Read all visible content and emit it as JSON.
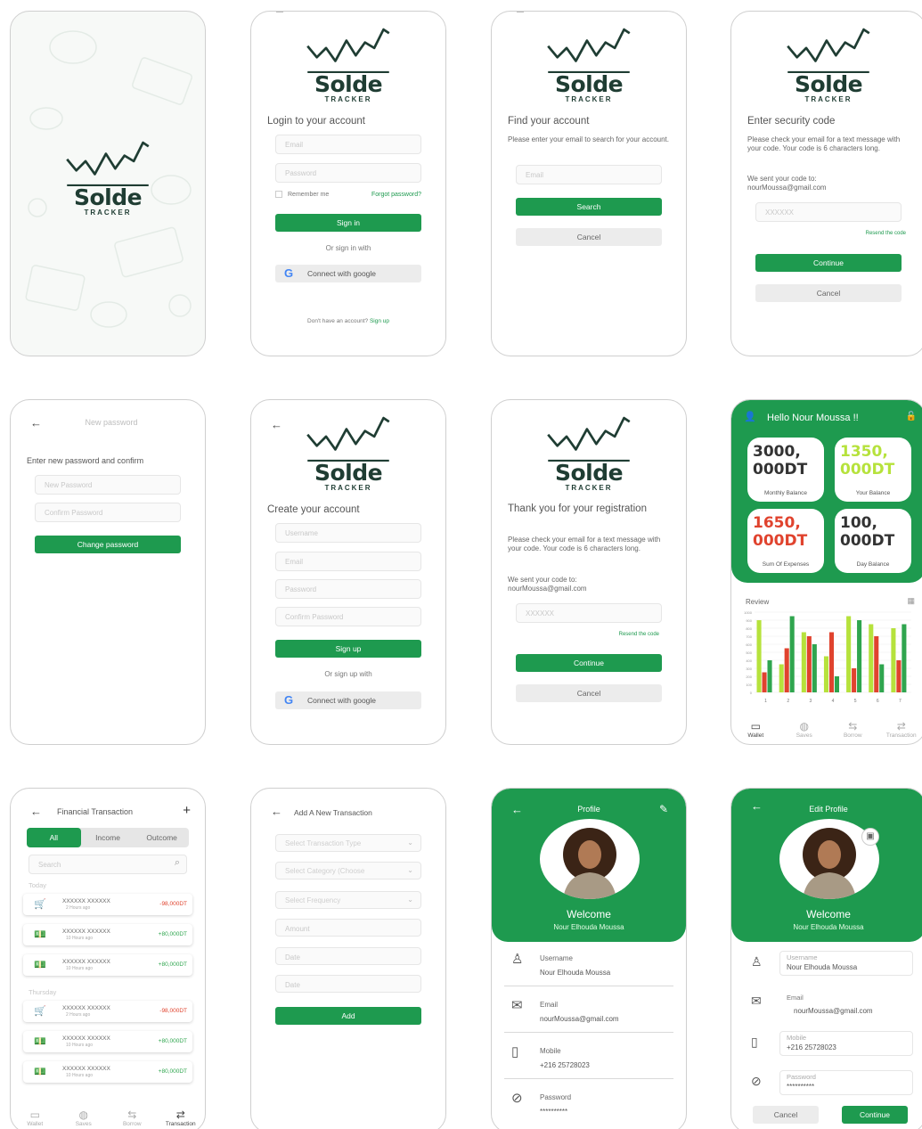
{
  "brand": {
    "name": "Solde",
    "sub": "TRACKER"
  },
  "login": {
    "heading": "Login to your account",
    "email_ph": "Email",
    "password_ph": "Password",
    "remember": "Remember me",
    "forgot": "Forgot password?",
    "signin": "Sign in",
    "or": "Or sign in with",
    "google": "Connect with google",
    "no_account": "Don't have an account?",
    "signup_link": "Sign up"
  },
  "find": {
    "heading": "Find your account",
    "para": "Please enter your email to search for your account.",
    "email_ph": "Email",
    "search": "Search",
    "cancel": "Cancel"
  },
  "security": {
    "heading": "Enter security code",
    "para": "Please check your email for a text message with your code. Your code is 6 characters long.",
    "sent_to": "We sent your code to:",
    "email": "nourMoussa@gmail.com",
    "code_ph": "XXXXXX",
    "resend": "Resend the code",
    "continue": "Continue",
    "cancel": "Cancel"
  },
  "newpw": {
    "title": "New password",
    "heading": "Enter new password and confirm",
    "new_ph": "New Password",
    "confirm_ph": "Confirm Password",
    "button": "Change password"
  },
  "create": {
    "heading": "Create your account",
    "username_ph": "Username",
    "email_ph": "Email",
    "password_ph": "Password",
    "confirm_ph": "Confirm Password",
    "signup": "Sign up",
    "or": "Or sign up with",
    "google": "Connect with google"
  },
  "thanks": {
    "heading": "Thank you for your registration",
    "para": "Please check your email for a text message with your code. Your code is 6 characters long.",
    "sent_to": "We sent your code to:",
    "email": "nourMoussa@gmail.com",
    "code_ph": "XXXXXX",
    "resend": "Resend the code",
    "continue": "Continue",
    "cancel": "Cancel"
  },
  "dashboard": {
    "hello": "Hello Nour Moussa !!",
    "cards": [
      {
        "value": "3000, 000DT",
        "label": "Monthly Balance",
        "color": "#333333"
      },
      {
        "value": "1350, 000DT",
        "label": "Your Balance",
        "color": "#b6e23c"
      },
      {
        "value": "1650, 000DT",
        "label": "Sum Of Expenses",
        "color": "#e0432e"
      },
      {
        "value": "100, 000DT",
        "label": "Day Balance",
        "color": "#333333"
      }
    ],
    "review": "Review"
  },
  "chart_data": {
    "type": "bar",
    "categories": [
      "1",
      "2",
      "3",
      "4",
      "5",
      "6",
      "7"
    ],
    "series": [
      {
        "values": [
          900,
          350,
          750,
          450,
          950,
          850,
          800
        ],
        "color": "#b6e23c"
      },
      {
        "values": [
          250,
          550,
          700,
          750,
          300,
          700,
          400
        ],
        "color": "#e0432e"
      },
      {
        "values": [
          400,
          950,
          600,
          200,
          900,
          350,
          850
        ],
        "color": "#2fa54e"
      }
    ],
    "ylim": [
      0,
      1000
    ],
    "yticks": [
      "0",
      "100",
      "200",
      "300",
      "400",
      "500",
      "600",
      "700",
      "800",
      "900",
      "1000"
    ],
    "grid": true
  },
  "nav": {
    "wallet": "Wallet",
    "saves": "Saves",
    "borrow": "Borrow",
    "transaction": "Transaction"
  },
  "transactions": {
    "title": "Financial Transaction",
    "tabs": [
      "All",
      "Income",
      "Outcome"
    ],
    "search_ph": "Search",
    "today": "Today",
    "thursday": "Thursday",
    "rows": [
      {
        "name": "XXXXXX XXXXXX",
        "time": "2 Hours ago",
        "amount": "-98,000DT",
        "type": "neg",
        "icon": "cart"
      },
      {
        "name": "XXXXXX XXXXXX",
        "time": "10 Hours ago",
        "amount": "+80,000DT",
        "type": "pos",
        "icon": "cash"
      },
      {
        "name": "XXXXXX XXXXXX",
        "time": "10 Hours ago",
        "amount": "+80,000DT",
        "type": "pos",
        "icon": "cash"
      },
      {
        "name": "XXXXXX XXXXXX",
        "time": "2 Hours ago",
        "amount": "-98,000DT",
        "type": "neg",
        "icon": "cart"
      },
      {
        "name": "XXXXXX XXXXXX",
        "time": "10 Hours ago",
        "amount": "+80,000DT",
        "type": "pos",
        "icon": "cash"
      },
      {
        "name": "XXXXXX XXXXXX",
        "time": "10 Hours ago",
        "amount": "+80,000DT",
        "type": "pos",
        "icon": "cash"
      }
    ]
  },
  "add": {
    "title": "Add A New Transaction",
    "type_ph": "Select Transaction Type",
    "category_ph": "Select Category (Choose",
    "frequency_ph": "Select Frequency",
    "amount_ph": "Amount",
    "date_ph": "Date",
    "date2_ph": "Date",
    "button": "Add"
  },
  "profile": {
    "title": "Profile",
    "welcome": "Welcome",
    "name": "Nour Elhouda Moussa",
    "username_label": "Username",
    "username": "Nour Elhouda Moussa",
    "email_label": "Email",
    "email": "nourMoussa@gmail.com",
    "mobile_label": "Mobile",
    "mobile": "+216 25728023",
    "password_label": "Password",
    "password": "**********"
  },
  "edit": {
    "title": "Edit Profile",
    "welcome": "Welcome",
    "name": "Nour Elhouda Moussa",
    "username_label": "Username",
    "username": "Nour Elhouda Moussa",
    "email_label": "Email",
    "email": "nourMoussa@gmail.com",
    "mobile_label": "Mobile",
    "mobile": "+216 25728023",
    "password_label": "Password",
    "password": "**********",
    "cancel": "Cancel",
    "continue": "Continue"
  }
}
